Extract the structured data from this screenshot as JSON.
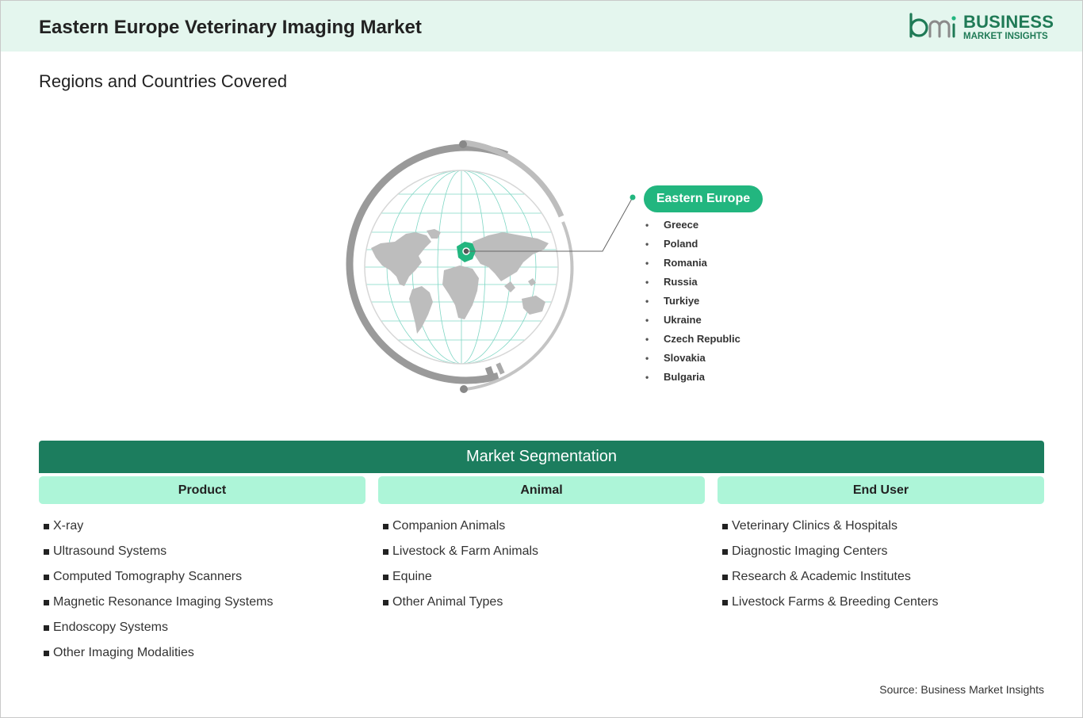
{
  "header": {
    "title": "Eastern Europe Veterinary Imaging Market",
    "logo": {
      "mark": "bmi",
      "line1": "BUSINESS",
      "line2": "MARKET INSIGHTS",
      "color": "#1f7a56"
    }
  },
  "regions": {
    "section_title": "Regions and Countries Covered",
    "region_label": "Eastern Europe",
    "countries": [
      "Greece",
      "Poland",
      "Romania",
      "Russia",
      "Turkiye",
      "Ukraine",
      "Czech Republic",
      "Slovakia",
      "Bulgaria"
    ],
    "highlight_color": "#22b67f"
  },
  "segmentation": {
    "banner": "Market Segmentation",
    "columns": [
      {
        "heading": "Product",
        "items": [
          "X-ray",
          "Ultrasound Systems",
          "Computed Tomography Scanners",
          "Magnetic Resonance Imaging Systems",
          "Endoscopy Systems",
          "Other Imaging Modalities"
        ]
      },
      {
        "heading": "Animal",
        "items": [
          "Companion Animals",
          "Livestock & Farm Animals",
          "Equine",
          "Other Animal Types"
        ]
      },
      {
        "heading": "End User",
        "items": [
          "Veterinary Clinics & Hospitals",
          "Diagnostic Imaging Centers",
          "Research & Academic Institutes",
          "Livestock Farms & Breeding Centers"
        ]
      }
    ],
    "banner_color": "#1c7d5e",
    "heading_color": "#adf5d8"
  },
  "source": "Source: Business Market Insights"
}
